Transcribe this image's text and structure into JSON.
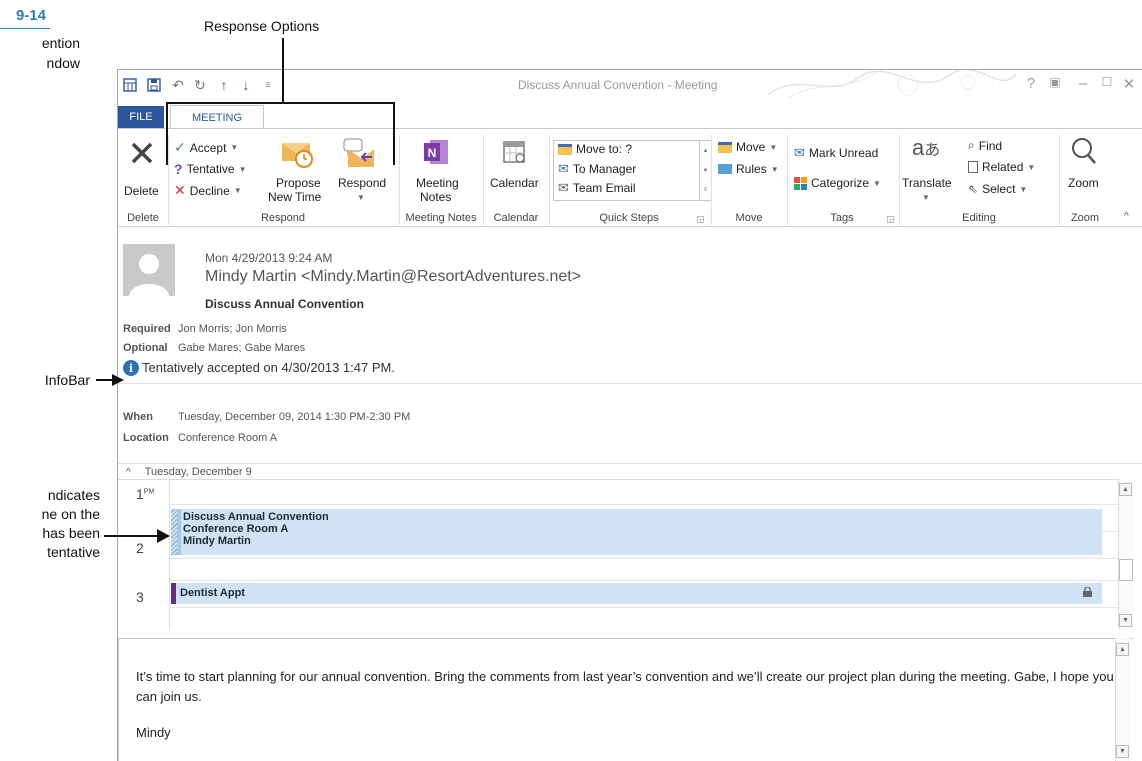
{
  "figure": {
    "number": "9-14",
    "caption_line1": "ention",
    "caption_line2": "ndow"
  },
  "annotations": {
    "response_options": "Response Options",
    "infobar": "InfoBar",
    "indicates_lines": [
      "ndicates",
      "ne on the",
      "has been",
      "tentative"
    ]
  },
  "window": {
    "title": "Discuss Annual Convention - Meeting",
    "help": "?",
    "tabs": [
      {
        "label": "FILE"
      },
      {
        "label": "MEETING"
      }
    ]
  },
  "ribbon": {
    "groups": {
      "delete": "Delete",
      "respond": "Respond",
      "meeting_notes": "Meeting Notes",
      "calendar": "Calendar",
      "quick_steps": "Quick Steps",
      "move": "Move",
      "tags": "Tags",
      "editing": "Editing",
      "zoom": "Zoom"
    },
    "buttons": {
      "delete": "Delete",
      "accept": "Accept",
      "tentative": "Tentative",
      "decline": "Decline",
      "propose_line1": "Propose",
      "propose_line2": "New Time",
      "respond": "Respond",
      "meeting_notes_line1": "Meeting",
      "meeting_notes_line2": "Notes",
      "calendar": "Calendar",
      "move": "Move",
      "rules": "Rules",
      "mark_unread": "Mark Unread",
      "categorize": "Categorize",
      "translate": "Translate",
      "find": "Find",
      "related": "Related",
      "select": "Select",
      "zoom": "Zoom"
    },
    "quick_steps": [
      "Move to: ?",
      "To Manager",
      "Team Email"
    ]
  },
  "message": {
    "date": "Mon 4/29/2013 9:24 AM",
    "from": "Mindy Martin <Mindy.Martin@ResortAdventures.net>",
    "subject": "Discuss Annual Convention",
    "required_label": "Required",
    "required_value": "Jon Morris; Jon Morris",
    "optional_label": "Optional",
    "optional_value": "Gabe Mares; Gabe Mares",
    "infobar": "Tentatively accepted on 4/30/2013 1:47 PM.",
    "when_label": "When",
    "when_value": "Tuesday, December 09, 2014 1:30 PM-2:30 PM",
    "location_label": "Location",
    "location_value": "Conference Room A"
  },
  "calendar": {
    "day_header": "Tuesday, December 9",
    "hours": [
      {
        "num": "1",
        "suffix": "PM"
      },
      {
        "num": "2",
        "suffix": ""
      },
      {
        "num": "3",
        "suffix": ""
      }
    ],
    "appointments": [
      {
        "lines": [
          "Discuss Annual Convention",
          "Conference Room A",
          "Mindy Martin"
        ],
        "status": "tentative"
      },
      {
        "lines": [
          "Dentist Appt"
        ],
        "status": "private"
      }
    ]
  },
  "body": {
    "text": "It’s time to start planning for our annual convention. Bring the comments from last year’s convention and we’ll create our project plan during the meeting. Gabe, I hope you can join us.",
    "signature": "Mindy"
  },
  "colors": {
    "accent": "#2b579a",
    "figure_blue": "#2d7fb5",
    "appointment": "#cfe3f4",
    "private_bar": "#6d2a84"
  }
}
